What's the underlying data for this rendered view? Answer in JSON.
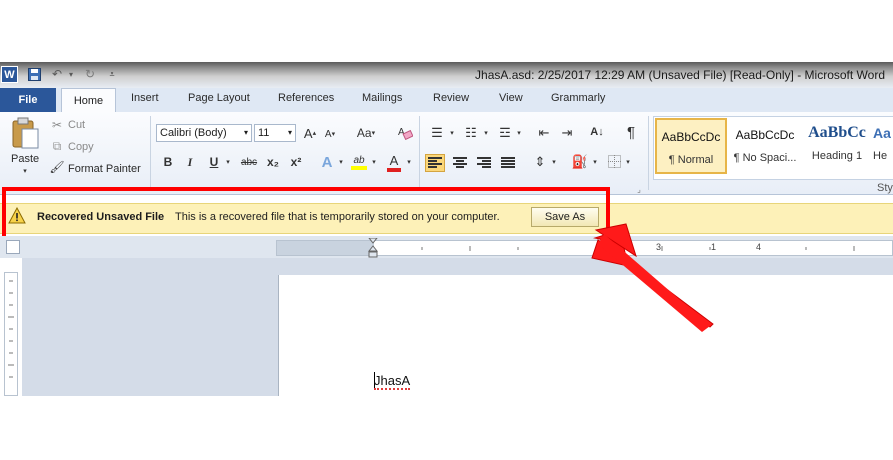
{
  "window": {
    "title": "JhasA.asd: 2/25/2017 12:29 AM (Unsaved File) [Read-Only]  -  Microsoft Word",
    "app_icon": "W"
  },
  "tabs": [
    "File",
    "Home",
    "Insert",
    "Page Layout",
    "References",
    "Mailings",
    "Review",
    "View",
    "Grammarly"
  ],
  "clipboard": {
    "paste": "Paste",
    "cut": "Cut",
    "copy": "Copy",
    "format_painter": "Format Painter"
  },
  "font": {
    "name": "Calibri (Body)",
    "size": "11",
    "case_btn": "Aa",
    "grow": "A",
    "shrink": "A",
    "bold": "B",
    "italic": "I",
    "underline": "U",
    "strike": "abc",
    "subscript": "x₂",
    "superscript": "x²",
    "highlight": "ab",
    "font_color": "A"
  },
  "styles": [
    {
      "sample": "AaBbCcDc",
      "name": "¶ Normal"
    },
    {
      "sample": "AaBbCcDc",
      "name": "¶ No Spaci..."
    },
    {
      "sample": "AaBbCc",
      "name": "Heading 1"
    },
    {
      "sample": "Aa",
      "name": "He"
    }
  ],
  "styles_group_label": "Sty",
  "message_bar": {
    "title": "Recovered Unsaved File",
    "text": "This is a recovered file that is temporarily stored on your computer.",
    "button": "Save As"
  },
  "ruler": {
    "numbers": [
      "3",
      "1",
      "4"
    ]
  },
  "document": {
    "text": "JhasA"
  },
  "colors": {
    "file_tab": "#2b579a",
    "message_bar": "#fdf1b8",
    "annotation": "#ff0000"
  }
}
